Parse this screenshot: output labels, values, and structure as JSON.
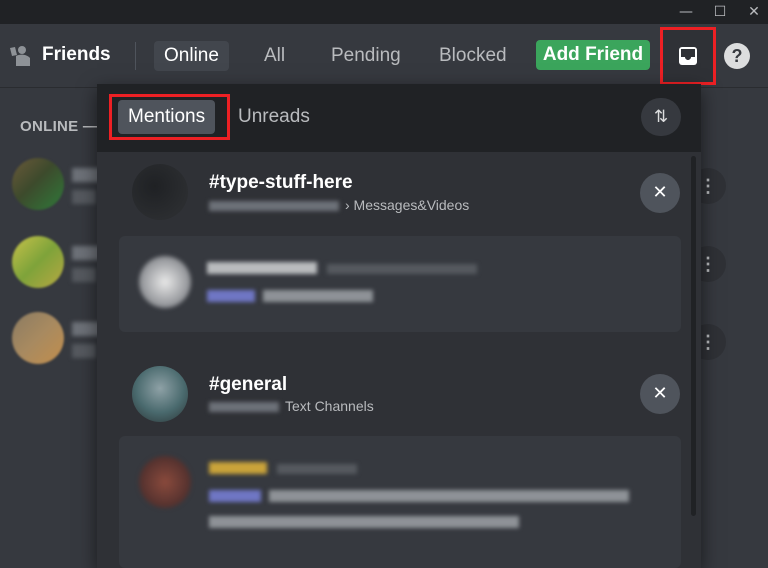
{
  "window": {
    "minimize_glyph": "—",
    "maximize_glyph": "☐",
    "close_glyph": "✕"
  },
  "header": {
    "title": "Friends",
    "tabs": [
      "Online",
      "All",
      "Pending",
      "Blocked"
    ],
    "active_tab": "Online",
    "add_friend_label": "Add Friend",
    "help_glyph": "?",
    "inbox_icon": "inbox-icon",
    "friends_icon": "friends-wave-icon"
  },
  "friends_list": {
    "section_header": "ONLINE —",
    "more_glyph": "⋮"
  },
  "inbox": {
    "tabs": [
      "Mentions",
      "Unreads"
    ],
    "active_tab": "Mentions",
    "sort_glyph": "⇅",
    "close_glyph": "✕",
    "groups": [
      {
        "channel": "#type-stuff-here",
        "category": "› Messages&Videos"
      },
      {
        "channel": "#general",
        "category": "Text Channels"
      }
    ]
  },
  "colors": {
    "accent_green": "#3ba55c",
    "highlight_red": "#ed2024",
    "background": "#36393f",
    "popout_background": "#2f3136"
  }
}
